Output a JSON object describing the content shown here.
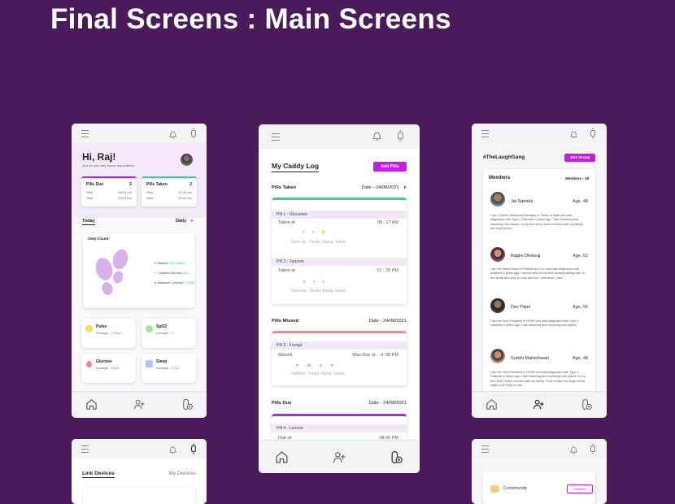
{
  "page": {
    "title": "Final Screens : Main Screens"
  },
  "home": {
    "greeting": "Hi, Raj!",
    "subtitle": "here are your daily reports and activities",
    "pills_due": {
      "label": "Pills Due",
      "count": "2",
      "rows": [
        {
          "name": "Glim",
          "time": "08:30 pm"
        },
        {
          "name": "Glim",
          "time": "09:00 pm"
        }
      ]
    },
    "pills_taken": {
      "label": "Pills Taken",
      "count": "2",
      "rows": [
        {
          "name": "Glim",
          "time": "12:30 pm"
        },
        {
          "name": "Glim",
          "time": "10:00 am"
        }
      ]
    },
    "today_label": "Today",
    "period": "Daily",
    "step_count": "Step Count",
    "walked": {
      "label": "Walked",
      "value": "7000 steps"
    },
    "calories": {
      "label": "Calories Burned",
      "value": "600"
    },
    "distance": {
      "label": "Distance Covered",
      "value": "7.5 KM"
    },
    "pulse": {
      "title": "Pulse",
      "label": "Average",
      "value": "72 bpm"
    },
    "spo2": {
      "title": "SpO2",
      "label": "Average",
      "value": "97"
    },
    "glucose": {
      "title": "Glucose",
      "label": "Average",
      "value": "mg/dl"
    },
    "sleep": {
      "title": "Sleep",
      "label": "Average",
      "value": "8 Hrs"
    }
  },
  "caddy": {
    "title": "My Caddy Log",
    "add_button": "Add Pills",
    "taken": {
      "label": "Pills Taken",
      "date": "Date - 24/08/2021"
    },
    "pill1": {
      "head": "Pill 1 - Glycomet",
      "status_label": "Taken at",
      "time": "09 : 17 AM",
      "seen": "Seen by - Farah, Asma, Sarah"
    },
    "pill2": {
      "head": "Pill 2 - Janovia",
      "status_label": "Taken at",
      "time": "01 : 20 PM",
      "seen": "Seen by - Farah, Asma, Sarah"
    },
    "missed": {
      "label": "Pills Missed",
      "date": "Date - 24/08/2021"
    },
    "pill3": {
      "head": "Pill 3 - Foziga",
      "status_label": "Missed",
      "time": "Was Due at : -4 :00 PM",
      "seen": "Notified : Farah, Asma, Sarah"
    },
    "due": {
      "label": "Pills Due",
      "date": "Date - 24/08/2021"
    },
    "pill4": {
      "head": "Pill 4 - Lenoun",
      "status_label": "Due at",
      "time": "08:00 PM"
    }
  },
  "group": {
    "tag": "#TheLaughGang",
    "join_button": "Join Group",
    "members_label": "Members",
    "members_count": "Members - 18",
    "members": [
      {
        "name": "Jai Sameta",
        "age": "Age, 48",
        "desc": "I am a Senior Marketing Manager in Times of India and was diagnosed with Type 2 Diabetes 3 years ago. I like travelling and exploring new places. In my free time I watch movies with my family and read books."
      },
      {
        "name": "Ragini Dhanraj",
        "age": "Age, 52",
        "desc": "I am the Sales Head of Fabasia and Co. and was diagnosed with diabetes 3 years ago. I spend most of my time working taking care of the family and love to cook and eat - whenever I can!"
      },
      {
        "name": "Dev Patel",
        "age": "Age, 56",
        "desc": "I am the Vice President in HHSB and was diagnosed with Type 2 Diabetes 4 years ago. I like travelling and exploring new places."
      },
      {
        "name": "Surbhi Maheshwari",
        "age": "Age, 48",
        "desc": "I am the Vice President in HHSB and was diagnosed with Type 2 Diabetes 8 years ago. I like travelling and exploring new places. In my free time I watch movies with my family. I love to take my dogs out for walks and I hate to eat!"
      }
    ]
  },
  "devices": {
    "tab_active": "Link Devices",
    "tab_other": "My Devices"
  },
  "community": {
    "label": "Community",
    "button": "Connect"
  },
  "colors": {
    "background": "#4a1a5a",
    "accent": "#c21fe3",
    "green": "#2ed3a0",
    "red": "#f08a8a"
  }
}
